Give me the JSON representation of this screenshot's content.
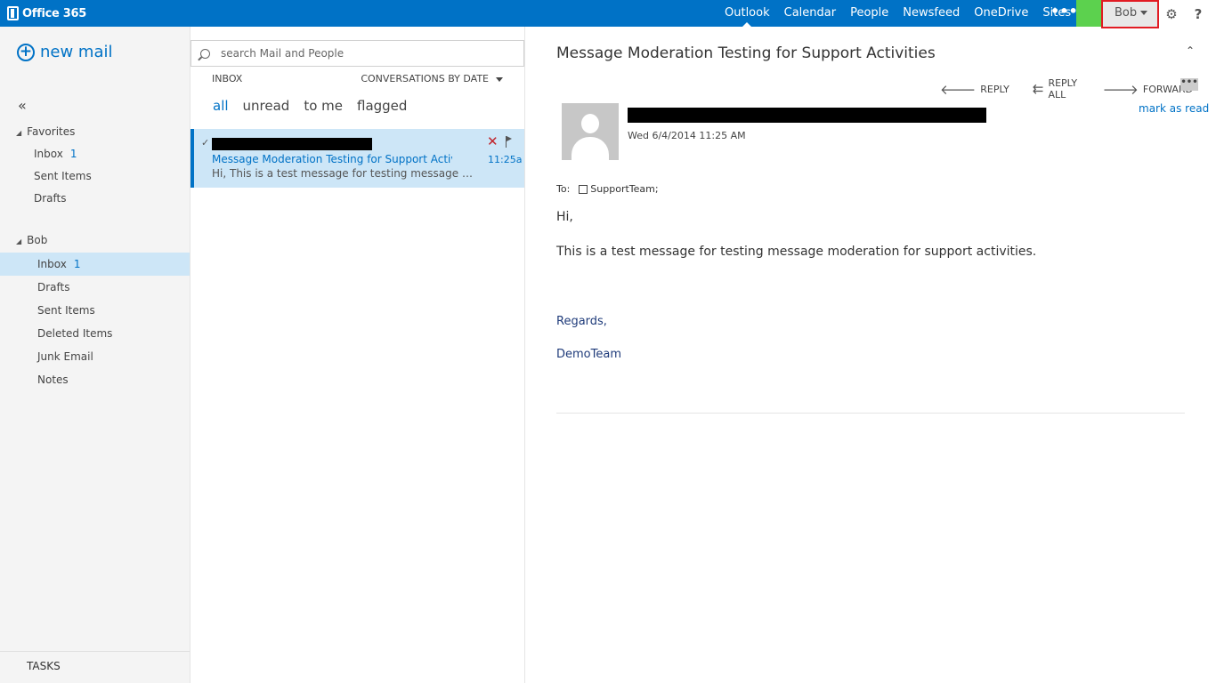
{
  "topbar": {
    "brand": "Office 365",
    "nav": [
      "Outlook",
      "Calendar",
      "People",
      "Newsfeed",
      "OneDrive",
      "Sites"
    ],
    "more": "•••",
    "user": "Bob",
    "settings_icon": "gear-icon",
    "help_icon": "?"
  },
  "leftnav": {
    "new_mail": "new mail",
    "collapse": "«",
    "favorites_header": "Favorites",
    "favorites": [
      {
        "label": "Inbox",
        "count": "1"
      },
      {
        "label": "Sent Items",
        "count": ""
      },
      {
        "label": "Drafts",
        "count": ""
      }
    ],
    "account_header": "Bob",
    "folders": [
      {
        "label": "Inbox",
        "count": "1"
      },
      {
        "label": "Drafts",
        "count": ""
      },
      {
        "label": "Sent Items",
        "count": ""
      },
      {
        "label": "Deleted Items",
        "count": ""
      },
      {
        "label": "Junk Email",
        "count": ""
      },
      {
        "label": "Notes",
        "count": ""
      }
    ],
    "tasks": "TASKS"
  },
  "msglist": {
    "search_placeholder": "search Mail and People",
    "title": "INBOX",
    "sort": "CONVERSATIONS BY DATE",
    "filters": [
      "all",
      "unread",
      "to me",
      "flagged"
    ],
    "message": {
      "subject": "Message Moderation Testing for Support Activities",
      "time": "11:25a",
      "preview": "Hi,  This is a test message for testing message moderation for support activities."
    }
  },
  "reading": {
    "subject": "Message Moderation Testing for Support Activities",
    "actions": [
      "REPLY",
      "REPLY ALL",
      "FORWARD"
    ],
    "more": "•••",
    "mark_read": "mark as read",
    "date": "Wed 6/4/2014 11:25 AM",
    "to_label": "To:",
    "to_value": "SupportTeam;",
    "greeting": "Hi,",
    "body": "This is a test message for testing message moderation for support activities.",
    "regards": "Regards,",
    "sign": "DemoTeam"
  },
  "colors": {
    "brand_blue": "#0072c6",
    "selected_bg": "#cde6f7",
    "accent_green": "#5cd14e",
    "highlight_red": "#e21b23"
  }
}
